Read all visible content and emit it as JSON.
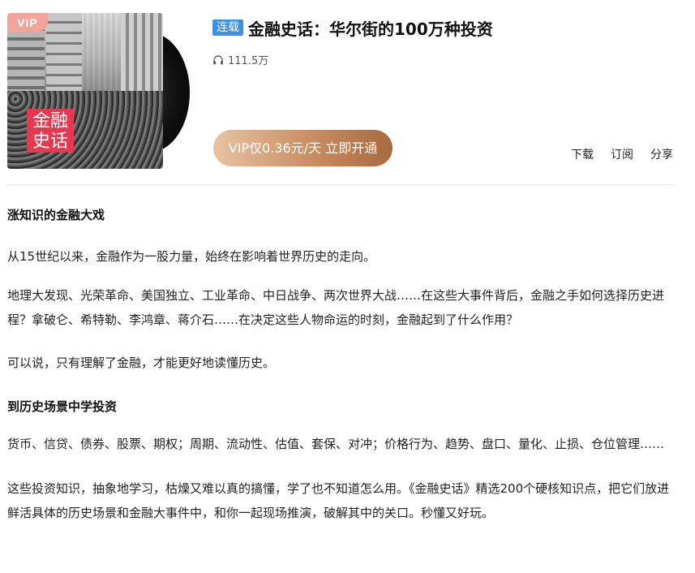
{
  "cover": {
    "vip_badge": "VIP",
    "logo_line1": "金融",
    "logo_line2": "史话"
  },
  "album": {
    "serial_tag": "连载",
    "title": "金融史话：华尔街的100万种投资",
    "play_count": "111.5万"
  },
  "vip_button_label": "VIP仅0.36元/天 立即开通",
  "actions": {
    "download": "下载",
    "subscribe": "订阅",
    "share": "分享"
  },
  "content": {
    "heading1": "涨知识的金融大戏",
    "para1": "从15世纪以来，金融作为一股力量，始终在影响着世界历史的走向。",
    "para2": "地理大发现、光荣革命、美国独立、工业革命、中日战争、两次世界大战……在这些大事件背后，金融之手如何选择历史进程？拿破仑、希特勒、李鸿章、蒋介石……在决定这些人物命运的时刻，金融起到了什么作用？",
    "para3": "可以说，只有理解了金融，才能更好地读懂历史。",
    "heading2": "到历史场景中学投资",
    "para4": "货币、信贷、债券、股票、期权；周期、流动性、估值、套保、对冲；价格行为、趋势、盘口、量化、止损、仓位管理……",
    "para5": "这些投资知识，抽象地学习，枯燥又难以真的搞懂，学了也不知道怎么用。《金融史话》精选200个硬核知识点，把它们放进鲜活具体的历史场景和金融大事件中，和你一起现场推演，破解其中的关口。秒懂又好玩。"
  },
  "colors": {
    "serial_tag": "#3d8fe8",
    "vip_button_start": "#e7c3a4",
    "vip_button_end": "#a86a40",
    "logo_red": "#e8384f",
    "vip_badge": "#f2a49a"
  },
  "icons": {
    "plays": "headphones-icon"
  }
}
